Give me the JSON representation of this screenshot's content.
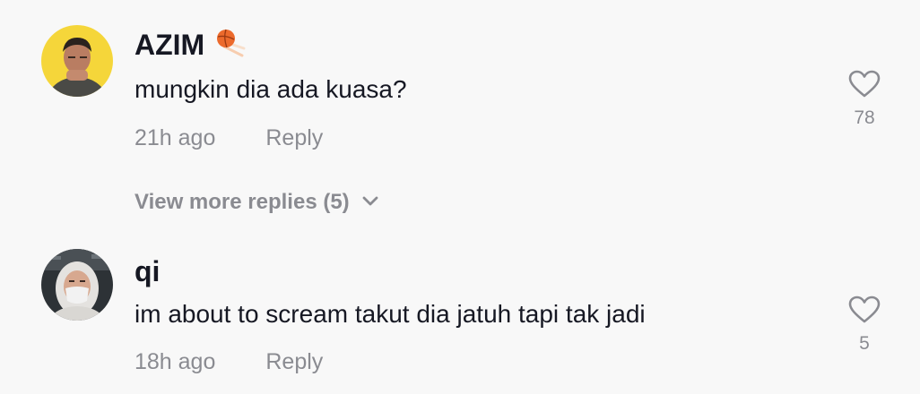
{
  "comments": [
    {
      "username": "AZIM",
      "text": "mungkin dia ada kuasa?",
      "time": "21h ago",
      "reply_label": "Reply",
      "likes": "78"
    },
    {
      "username": "qi",
      "text": "im about to scream takut dia jatuh tapi tak jadi",
      "time": "18h ago",
      "reply_label": "Reply",
      "likes": "5"
    }
  ],
  "view_more_replies": "View more replies (5)",
  "colors": {
    "background": "#f8f8f8",
    "primary_text": "#161823",
    "secondary_text": "#8a8b91"
  },
  "icons": {
    "badge": "basketball-icon",
    "like": "heart-outline-icon",
    "expand": "chevron-down-icon"
  }
}
